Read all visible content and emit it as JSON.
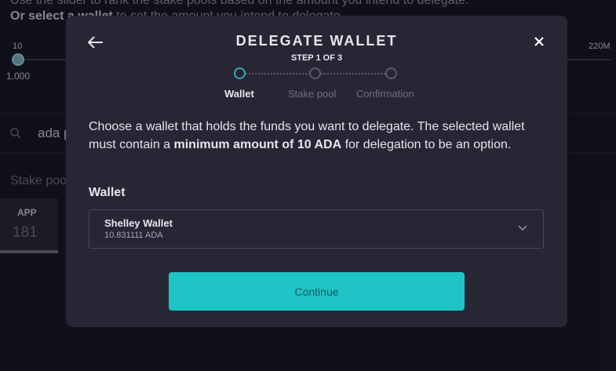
{
  "background": {
    "intro_line1": "Use the slider to rank the stake pools based on the amount you intend to delegate.",
    "intro_line2_bold": "Or select a wallet",
    "intro_line2_rest": " to set the amount you intend to delegate.",
    "slider": {
      "min_label": "10",
      "max_label": "220M",
      "value_label": "1,000"
    },
    "search": {
      "value": "ada p"
    },
    "stake_pools_label": "Stake poo",
    "tab": {
      "label": "APP",
      "count": "181"
    }
  },
  "modal": {
    "title": "DELEGATE WALLET",
    "step_indicator": "STEP 1 OF 3",
    "steps": [
      {
        "label": "Wallet",
        "active": true
      },
      {
        "label": "Stake pool",
        "active": false
      },
      {
        "label": "Confirmation",
        "active": false
      }
    ],
    "description_before": "Choose a wallet that holds the funds you want to delegate. The selected wallet must contain a ",
    "description_bold": "minimum amount of 10 ADA",
    "description_after": " for delegation to be an option.",
    "wallet_label": "Wallet",
    "selected_wallet": {
      "name": "Shelley Wallet",
      "amount": "10.831111 ADA"
    },
    "continue_label": "Continue"
  },
  "colors": {
    "accent": "#1fc4c6",
    "modal_bg": "#262635",
    "page_bg": "#15151f"
  }
}
